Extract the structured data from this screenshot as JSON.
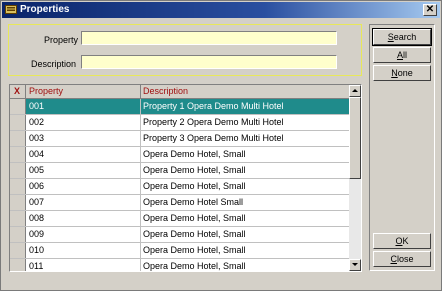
{
  "window": {
    "title": "Properties",
    "close_label": "✕"
  },
  "search": {
    "property_label": "Property",
    "property_value": "",
    "description_label": "Description",
    "description_value": ""
  },
  "buttons": {
    "search": "Search",
    "all": "All",
    "none": "None",
    "ok": "OK",
    "close": "Close"
  },
  "grid": {
    "columns": {
      "marker": "X",
      "property": "Property",
      "description": "Description"
    },
    "rows": [
      {
        "property": "001",
        "description": "Property 1 Opera Demo Multi Hotel"
      },
      {
        "property": "002",
        "description": "Property 2 Opera Demo Multi Hotel"
      },
      {
        "property": "003",
        "description": "Property 3 Opera Demo Multi Hotel"
      },
      {
        "property": "004",
        "description": "Opera Demo Hotel, Small"
      },
      {
        "property": "005",
        "description": "Opera Demo Hotel, Small"
      },
      {
        "property": "006",
        "description": "Opera Demo Hotel, Small"
      },
      {
        "property": "007",
        "description": "Opera Demo Hotel Small"
      },
      {
        "property": "008",
        "description": "Opera Demo Hotel, Small"
      },
      {
        "property": "009",
        "description": "Opera Demo Hotel, Small"
      },
      {
        "property": "010",
        "description": "Opera Demo Hotel, Small"
      },
      {
        "property": "011",
        "description": "Opera Demo Hotel, Small"
      }
    ],
    "selected_row": 0
  },
  "colors": {
    "title_bar": "#0a246a",
    "selected_row": "#1f8b8b",
    "input_bg": "#ffffcc",
    "header_text": "#a01010"
  }
}
